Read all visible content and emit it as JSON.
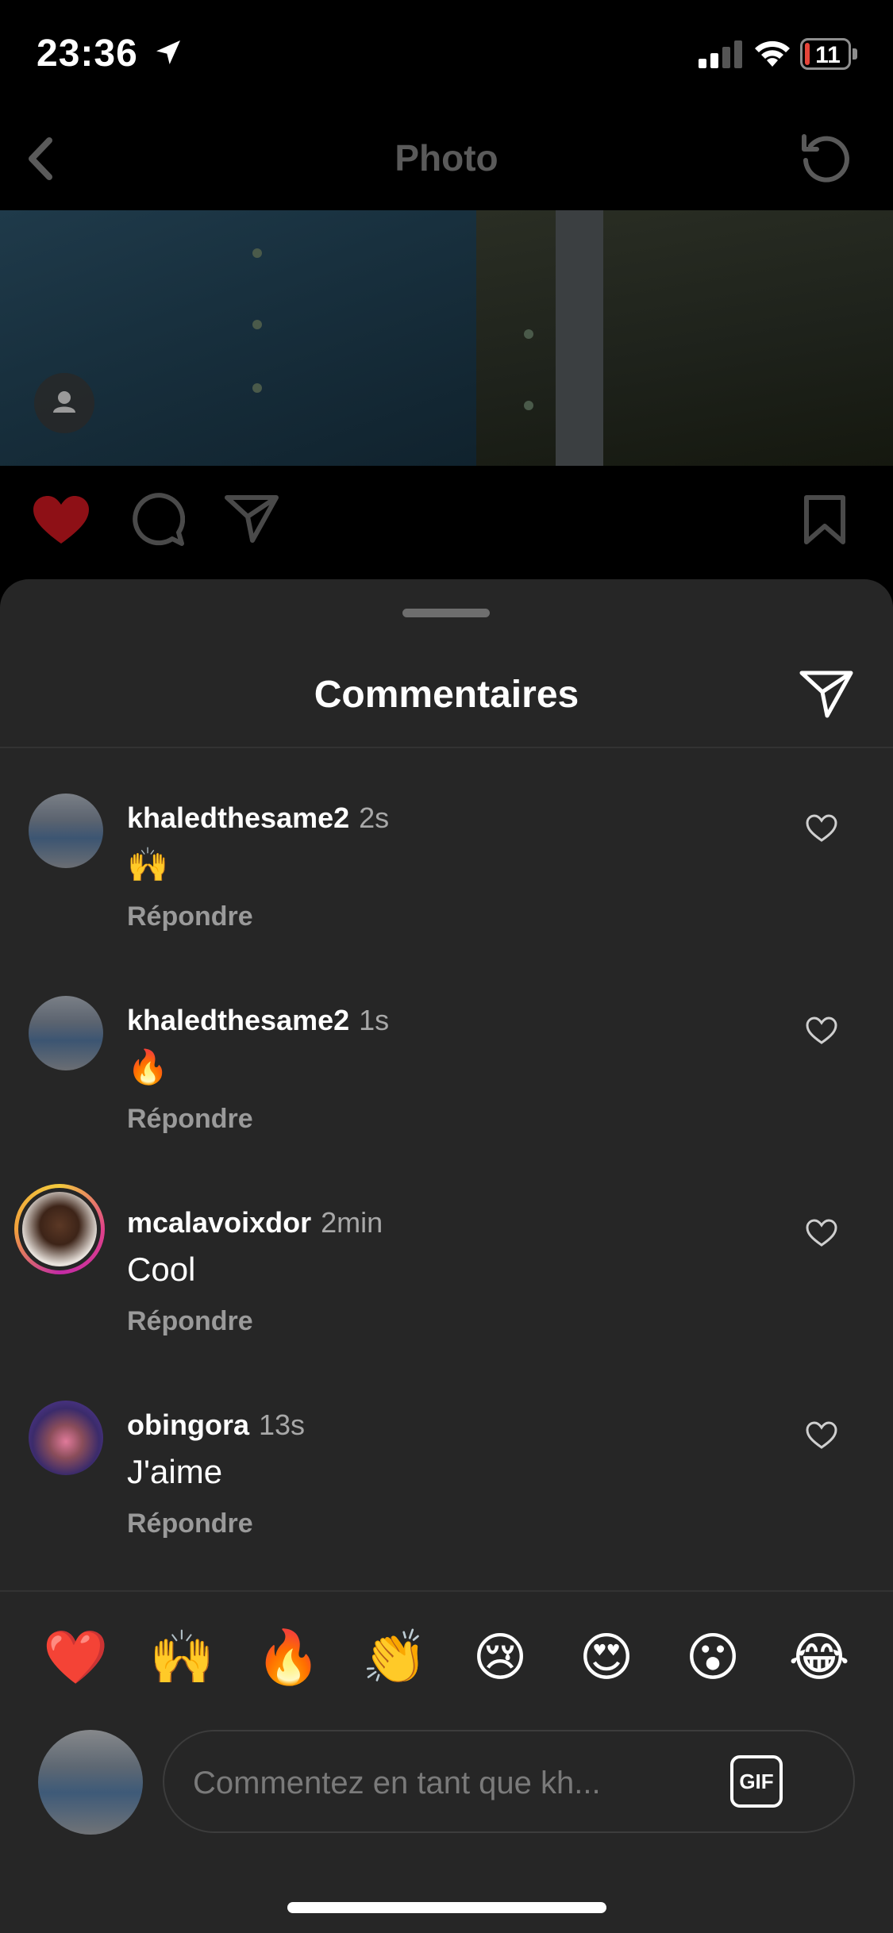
{
  "status_bar": {
    "time": "23:36",
    "battery": "11",
    "battery_level": 0.11,
    "battery_color": "#e5453a"
  },
  "nav": {
    "title": "Photo"
  },
  "post": {
    "liked": true,
    "like_color": "#c0131d"
  },
  "sheet": {
    "title": "Commentaires"
  },
  "comments": [
    {
      "username": "khaledthesame2",
      "time": "2s",
      "text": "🙌",
      "reply": "Répondre"
    },
    {
      "username": "khaledthesame2",
      "time": "1s",
      "text": "🔥",
      "reply": "Répondre"
    },
    {
      "username": "mcalavoixdor",
      "time": "2min",
      "text": "Cool",
      "reply": "Répondre"
    },
    {
      "username": "obingora",
      "time": "13s",
      "text": "J'aime",
      "reply": "Répondre"
    }
  ],
  "quick_emojis": [
    "❤️",
    "🙌",
    "🔥",
    "👏",
    "😢",
    "😍",
    "😮",
    "😂"
  ],
  "composer": {
    "placeholder": "Commentez en tant que kh...",
    "gif_label": "GIF"
  },
  "colors": {
    "background": "#000000",
    "sheet": "#262626",
    "muted": "#9a9a9a"
  }
}
